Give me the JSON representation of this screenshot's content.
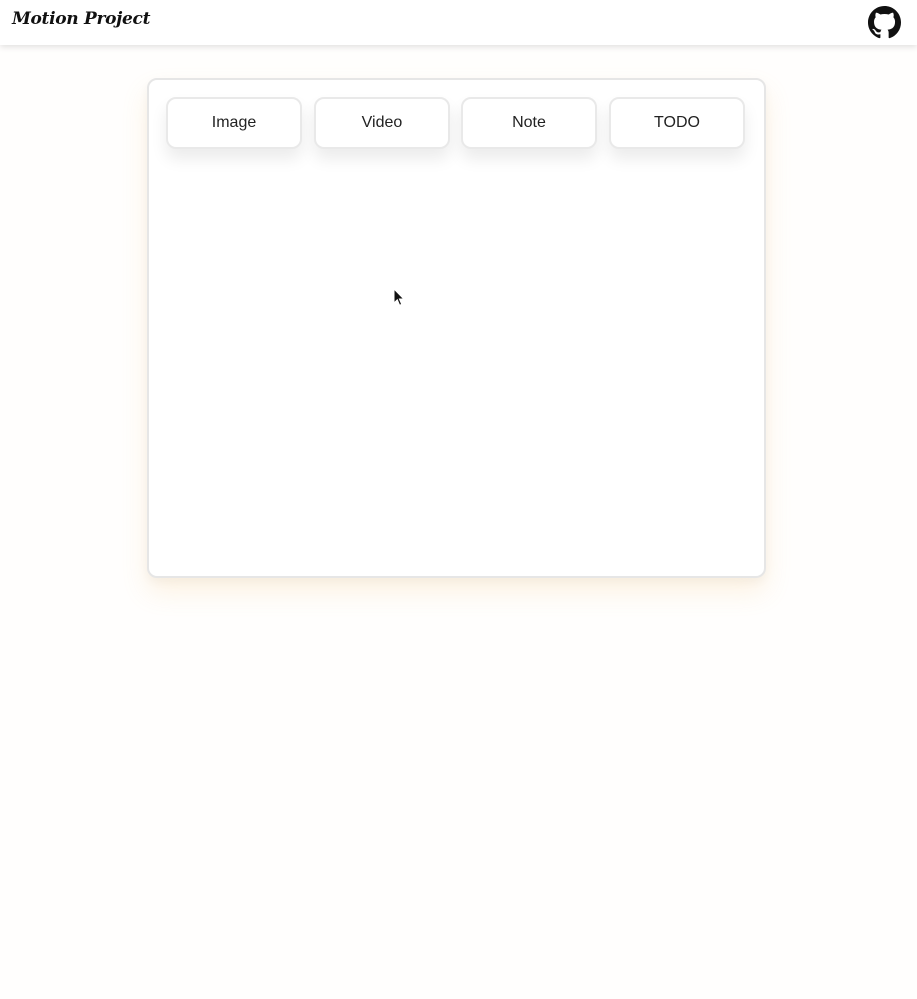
{
  "header": {
    "title": "Motion Project",
    "github_icon": "github-icon"
  },
  "toolbar": {
    "buttons": [
      {
        "label": "Image"
      },
      {
        "label": "Video"
      },
      {
        "label": "Note"
      },
      {
        "label": "TODO"
      }
    ]
  },
  "colors": {
    "background": "#fffefd",
    "board_border": "#e6e6e6",
    "board_glow": "#f5b45a"
  }
}
